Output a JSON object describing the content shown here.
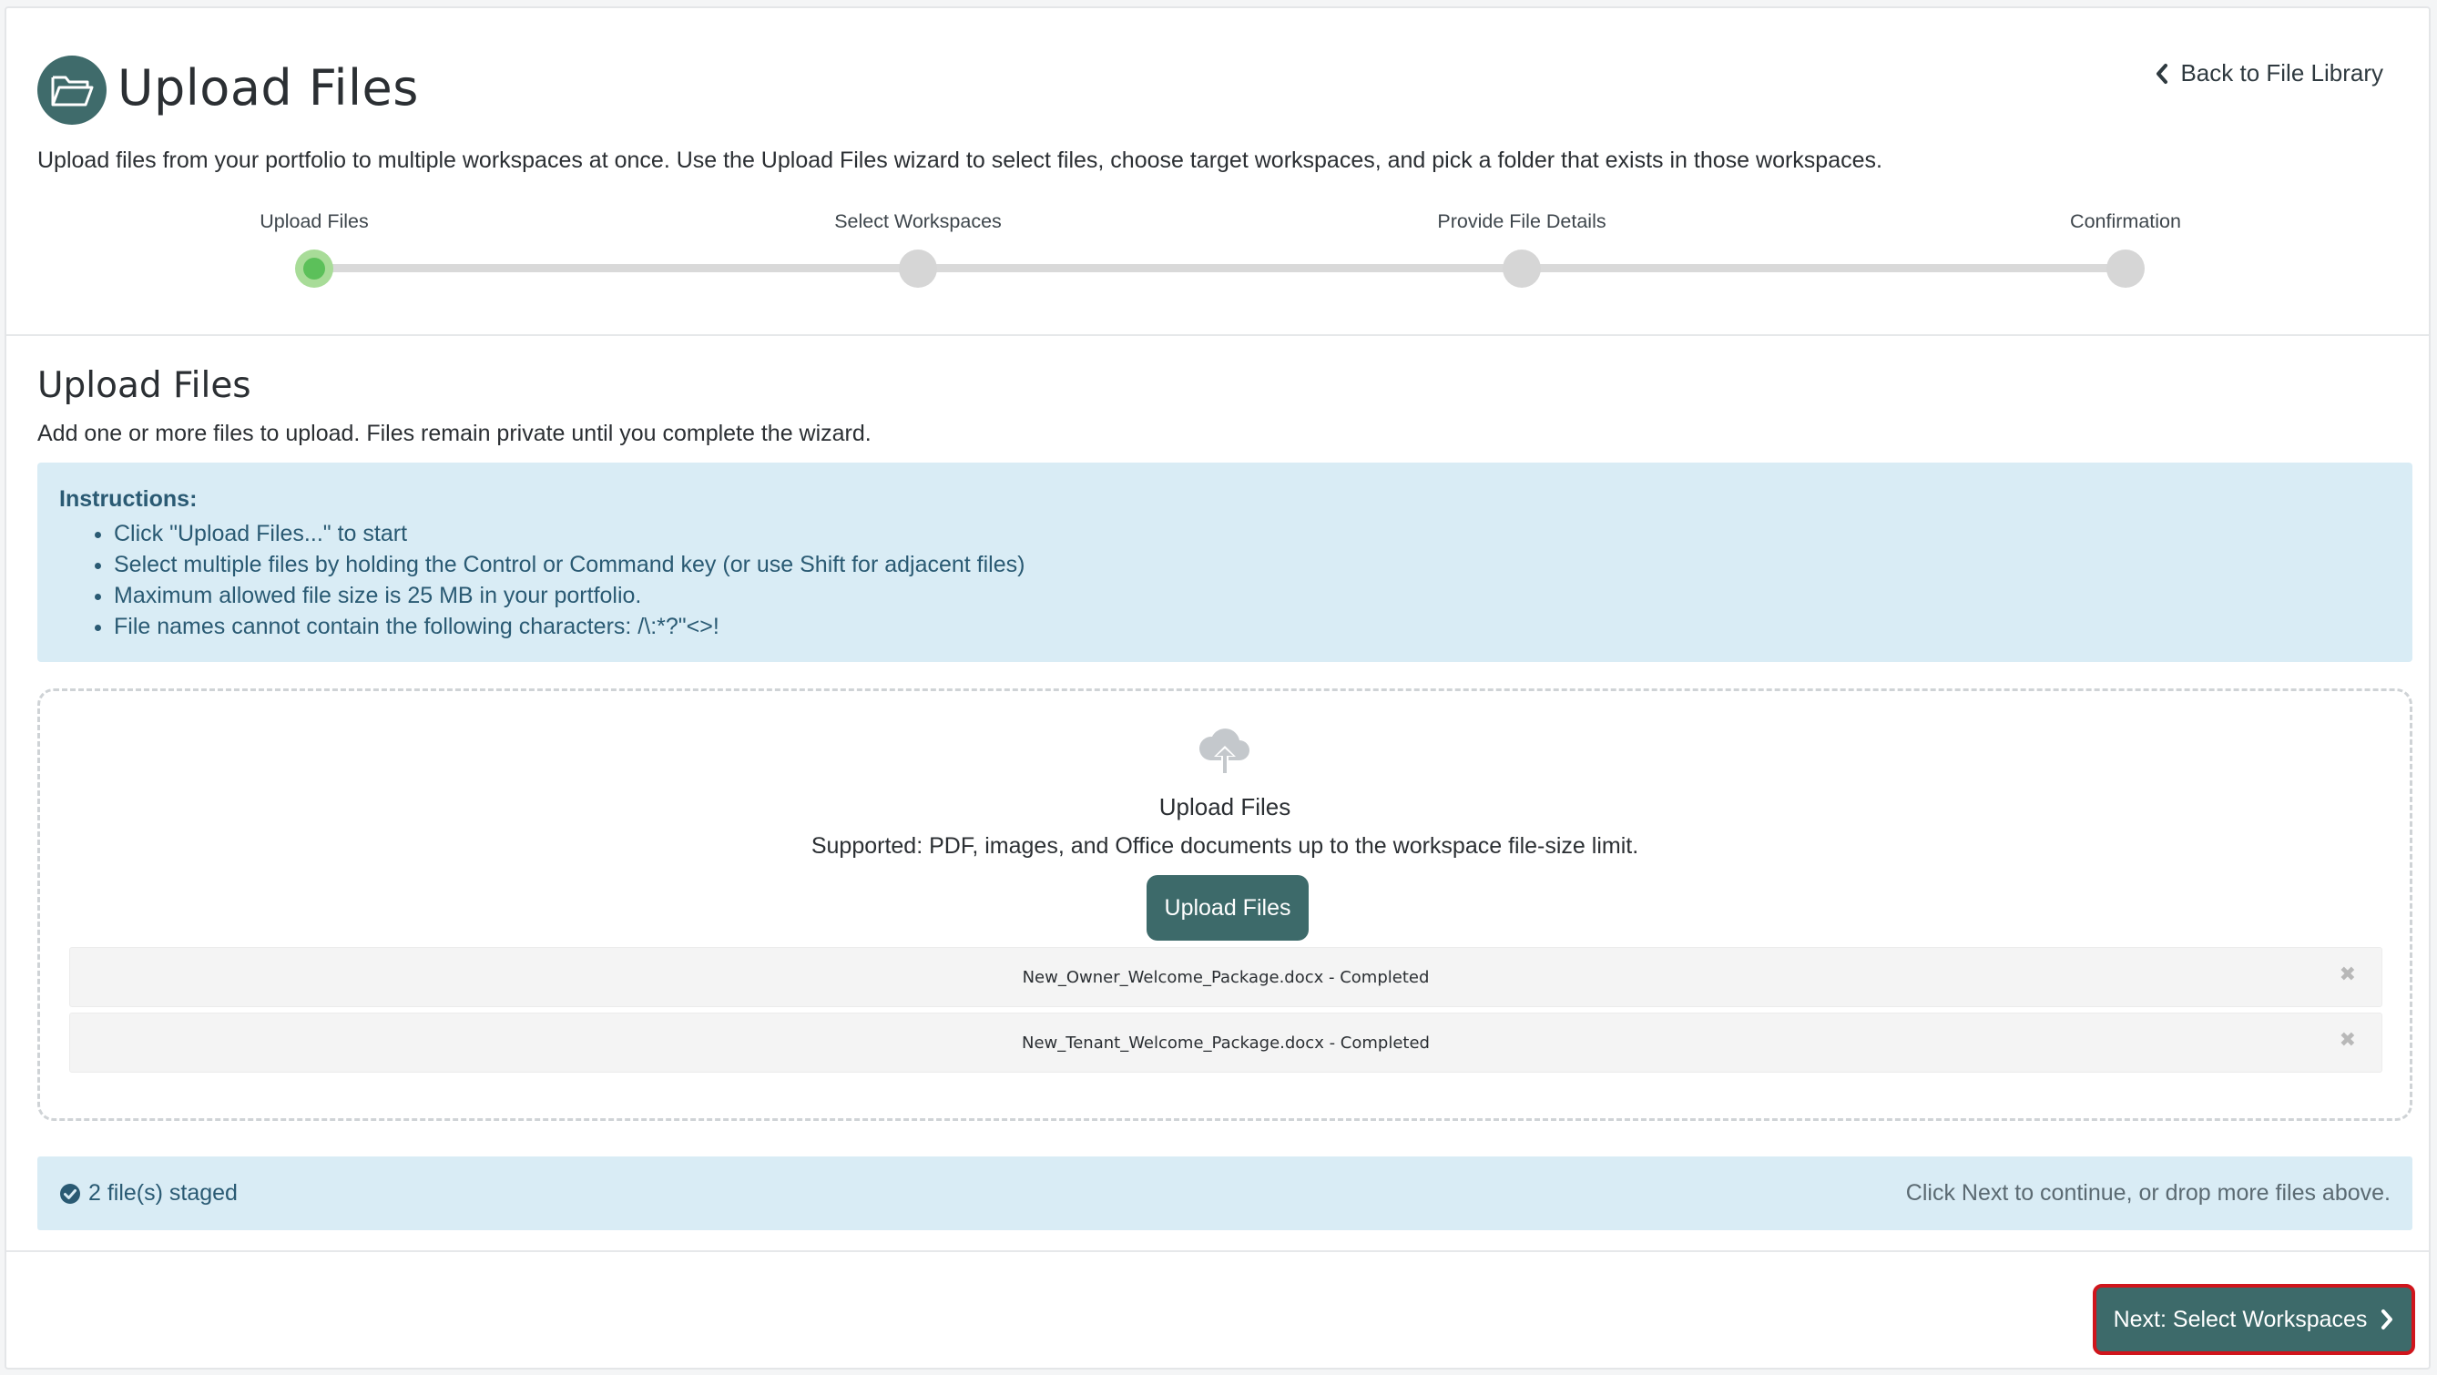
{
  "header": {
    "title": "Upload Files",
    "back_link": "Back to File Library",
    "intro": "Upload files from your portfolio to multiple workspaces at once. Use the Upload Files wizard to select files, choose target workspaces, and pick a folder that exists in those workspaces."
  },
  "stepper": {
    "steps": [
      {
        "label": "Upload Files",
        "active": true
      },
      {
        "label": "Select Workspaces",
        "active": false
      },
      {
        "label": "Provide File Details",
        "active": false
      },
      {
        "label": "Confirmation",
        "active": false
      }
    ],
    "colors": {
      "active": "#5cc05a",
      "inactive": "#d6d6d6"
    }
  },
  "section": {
    "title": "Upload Files",
    "description": "Add one or more files to upload. Files remain private until you complete the wizard."
  },
  "instructions": {
    "title": "Instructions:",
    "items": [
      "Click \"Upload Files...\" to start",
      "Select multiple files by holding the Control or Command key (or use Shift for adjacent files)",
      "Maximum allowed file size is 25 MB in your portfolio.",
      "File names cannot contain the following characters: /\\:*?\"<>!"
    ]
  },
  "dropzone": {
    "icon": "cloud-upload-icon",
    "title": "Upload Files",
    "supported": "Supported: PDF, images, and Office documents up to the workspace file-size limit.",
    "button_label": "Upload Files",
    "files": [
      {
        "name": "New_Owner_Welcome_Package.docx - Completed",
        "remove_icon": "✖"
      },
      {
        "name": "New_Tenant_Welcome_Package.docx - Completed",
        "remove_icon": "✖"
      }
    ]
  },
  "status": {
    "staged": "2 file(s) staged",
    "hint": "Click Next to continue, or drop more files above."
  },
  "footer": {
    "next_label": "Next: Select Workspaces"
  },
  "colors": {
    "brand": "#3d6a6a",
    "info_bg": "#d9ecf5",
    "highlight_border": "#d0151c"
  }
}
